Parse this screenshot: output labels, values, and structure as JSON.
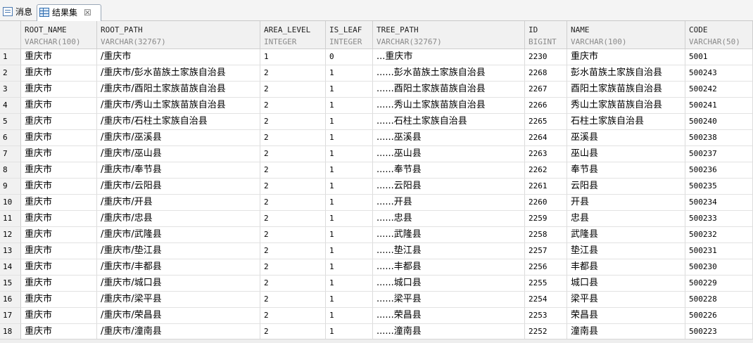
{
  "tabs": [
    {
      "label": "消息",
      "icon": "message-icon"
    },
    {
      "label": "结果集",
      "icon": "table-icon",
      "close": "☒"
    }
  ],
  "columns": [
    {
      "name": "ROOT_NAME",
      "type": "VARCHAR(100)"
    },
    {
      "name": "ROOT_PATH",
      "type": "VARCHAR(32767)"
    },
    {
      "name": "AREA_LEVEL",
      "type": "INTEGER"
    },
    {
      "name": "IS_LEAF",
      "type": "INTEGER"
    },
    {
      "name": "TREE_PATH",
      "type": "VARCHAR(32767)"
    },
    {
      "name": "ID",
      "type": "BIGINT"
    },
    {
      "name": "NAME",
      "type": "VARCHAR(100)"
    },
    {
      "name": "CODE",
      "type": "VARCHAR(50)"
    }
  ],
  "rows": [
    {
      "n": "1",
      "c": [
        "重庆市",
        "/重庆市",
        "1",
        "0",
        "...重庆市",
        "2230",
        "重庆市",
        "5001"
      ]
    },
    {
      "n": "2",
      "c": [
        "重庆市",
        "/重庆市/彭水苗族土家族自治县",
        "2",
        "1",
        "......彭水苗族土家族自治县",
        "2268",
        "彭水苗族土家族自治县",
        "500243"
      ]
    },
    {
      "n": "3",
      "c": [
        "重庆市",
        "/重庆市/酉阳土家族苗族自治县",
        "2",
        "1",
        "......酉阳土家族苗族自治县",
        "2267",
        "酉阳土家族苗族自治县",
        "500242"
      ]
    },
    {
      "n": "4",
      "c": [
        "重庆市",
        "/重庆市/秀山土家族苗族自治县",
        "2",
        "1",
        "......秀山土家族苗族自治县",
        "2266",
        "秀山土家族苗族自治县",
        "500241"
      ]
    },
    {
      "n": "5",
      "c": [
        "重庆市",
        "/重庆市/石柱土家族自治县",
        "2",
        "1",
        "......石柱土家族自治县",
        "2265",
        "石柱土家族自治县",
        "500240"
      ]
    },
    {
      "n": "6",
      "c": [
        "重庆市",
        "/重庆市/巫溪县",
        "2",
        "1",
        "......巫溪县",
        "2264",
        "巫溪县",
        "500238"
      ]
    },
    {
      "n": "7",
      "c": [
        "重庆市",
        "/重庆市/巫山县",
        "2",
        "1",
        "......巫山县",
        "2263",
        "巫山县",
        "500237"
      ]
    },
    {
      "n": "8",
      "c": [
        "重庆市",
        "/重庆市/奉节县",
        "2",
        "1",
        "......奉节县",
        "2262",
        "奉节县",
        "500236"
      ]
    },
    {
      "n": "9",
      "c": [
        "重庆市",
        "/重庆市/云阳县",
        "2",
        "1",
        "......云阳县",
        "2261",
        "云阳县",
        "500235"
      ]
    },
    {
      "n": "10",
      "c": [
        "重庆市",
        "/重庆市/开县",
        "2",
        "1",
        "......开县",
        "2260",
        "开县",
        "500234"
      ]
    },
    {
      "n": "11",
      "c": [
        "重庆市",
        "/重庆市/忠县",
        "2",
        "1",
        "......忠县",
        "2259",
        "忠县",
        "500233"
      ]
    },
    {
      "n": "12",
      "c": [
        "重庆市",
        "/重庆市/武隆县",
        "2",
        "1",
        "......武隆县",
        "2258",
        "武隆县",
        "500232"
      ]
    },
    {
      "n": "13",
      "c": [
        "重庆市",
        "/重庆市/垫江县",
        "2",
        "1",
        "......垫江县",
        "2257",
        "垫江县",
        "500231"
      ]
    },
    {
      "n": "14",
      "c": [
        "重庆市",
        "/重庆市/丰都县",
        "2",
        "1",
        "......丰都县",
        "2256",
        "丰都县",
        "500230"
      ]
    },
    {
      "n": "15",
      "c": [
        "重庆市",
        "/重庆市/城口县",
        "2",
        "1",
        "......城口县",
        "2255",
        "城口县",
        "500229"
      ]
    },
    {
      "n": "16",
      "c": [
        "重庆市",
        "/重庆市/梁平县",
        "2",
        "1",
        "......梁平县",
        "2254",
        "梁平县",
        "500228"
      ]
    },
    {
      "n": "17",
      "c": [
        "重庆市",
        "/重庆市/荣昌县",
        "2",
        "1",
        "......荣昌县",
        "2253",
        "荣昌县",
        "500226"
      ]
    },
    {
      "n": "18",
      "c": [
        "重庆市",
        "/重庆市/潼南县",
        "2",
        "1",
        "......潼南县",
        "2252",
        "潼南县",
        "500223"
      ]
    }
  ]
}
